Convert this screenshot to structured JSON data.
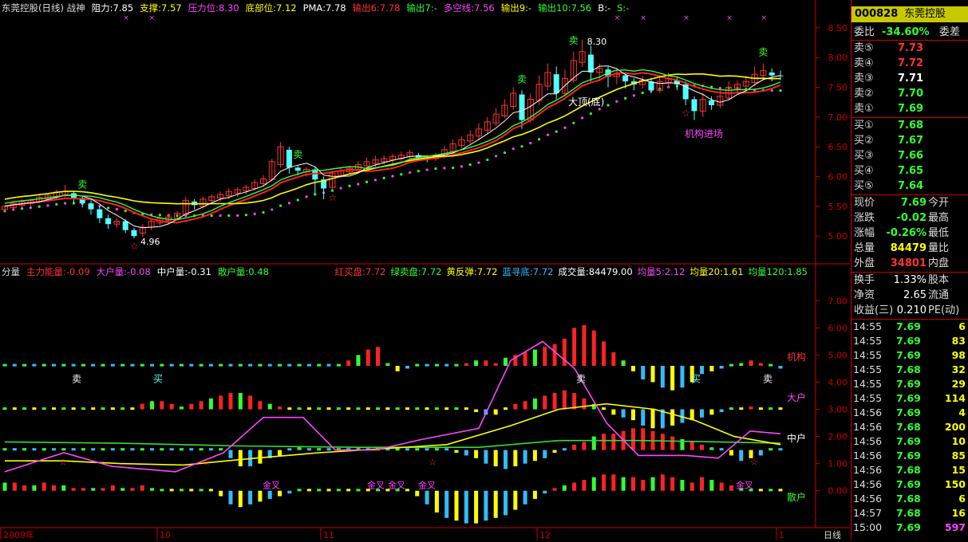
{
  "top_header": {
    "items": [
      {
        "text": "东莞控股(日线) 战神",
        "color": "#dddddd"
      },
      {
        "text": "阻力:7.85",
        "color": "#ffffff"
      },
      {
        "text": "支撑:7.57",
        "color": "#ffff00"
      },
      {
        "text": "压力位:8.30",
        "color": "#ff44ff"
      },
      {
        "text": "底部位:7.12",
        "color": "#ffff00"
      },
      {
        "text": "PMA:7.78",
        "color": "#ffffff"
      },
      {
        "text": "输出6:7.78",
        "color": "#ff3333"
      },
      {
        "text": "输出7:-",
        "color": "#33ff33"
      },
      {
        "text": "多空线:7.56",
        "color": "#ff44ff"
      },
      {
        "text": "输出9:-",
        "color": "#ffff00"
      },
      {
        "text": "输出10:7.56",
        "color": "#33ff33"
      },
      {
        "text": "B:-",
        "color": "#ffffff"
      },
      {
        "text": "S:-",
        "color": "#33ff33"
      }
    ]
  },
  "sub_header": {
    "left_items": [
      {
        "text": "分量",
        "color": "#dddddd"
      },
      {
        "text": "主力能量:-0.09",
        "color": "#ff3333"
      },
      {
        "text": "大户量:-0.08",
        "color": "#ff44ff"
      },
      {
        "text": "中户量:-0.31",
        "color": "#ffffff"
      },
      {
        "text": "散户量:0.48",
        "color": "#33ff33"
      }
    ],
    "right_items": [
      {
        "text": "红买盘:7.72",
        "color": "#ff3333"
      },
      {
        "text": "绿卖盘:7.72",
        "color": "#33ff33"
      },
      {
        "text": "黄反弹:7.72",
        "color": "#ffff00"
      },
      {
        "text": "蓝寻底:7.72",
        "color": "#33bbff"
      },
      {
        "text": "成交量:84479.00",
        "color": "#ffffff"
      },
      {
        "text": "均量5:2.12",
        "color": "#ff44ff"
      },
      {
        "text": "均量20:1.61",
        "color": "#ffff00"
      },
      {
        "text": "均量120:1.85",
        "color": "#33ff33"
      }
    ]
  },
  "chart_data": [
    {
      "type": "candlestick",
      "title": "东莞控股(日线)",
      "y_ticks": [
        "8.50",
        "8.00",
        "7.50",
        "7.00",
        "6.50",
        "6.00",
        "5.50",
        "5.00"
      ],
      "ylim": [
        4.6,
        8.7
      ],
      "x_labels": [
        "2009年",
        "10",
        "11",
        "12",
        "1"
      ],
      "annotations": [
        {
          "text": "大顶(底)",
          "color": "#ffffff"
        },
        {
          "text": "机构进场",
          "color": "#ff44ff"
        },
        {
          "text": "8.30",
          "color": "#ffffff"
        },
        {
          "text": "4.96",
          "color": "#ffffff"
        }
      ],
      "sell_label": "卖",
      "buy_label": "买",
      "candles": [
        [
          5.45,
          5.5,
          5.4,
          5.52
        ],
        [
          5.48,
          5.55,
          5.45,
          5.58
        ],
        [
          5.52,
          5.58,
          5.48,
          5.62
        ],
        [
          5.55,
          5.6,
          5.5,
          5.63
        ],
        [
          5.58,
          5.65,
          5.55,
          5.68
        ],
        [
          5.62,
          5.68,
          5.58,
          5.72
        ],
        [
          5.66,
          5.74,
          5.62,
          5.78
        ],
        [
          5.7,
          5.75,
          5.65,
          5.86
        ],
        [
          5.72,
          5.64,
          5.55,
          5.76
        ],
        [
          5.64,
          5.55,
          5.48,
          5.68
        ],
        [
          5.55,
          5.45,
          5.36,
          5.6
        ],
        [
          5.45,
          5.3,
          5.22,
          5.5
        ],
        [
          5.3,
          5.2,
          5.12,
          5.36
        ],
        [
          5.2,
          5.25,
          5.14,
          5.3
        ],
        [
          5.25,
          5.1,
          5.05,
          5.28
        ],
        [
          5.1,
          5.0,
          4.96,
          5.14
        ],
        [
          5.05,
          5.15,
          4.98,
          5.2
        ],
        [
          5.15,
          5.25,
          5.1,
          5.28
        ],
        [
          5.22,
          5.3,
          5.18,
          5.34
        ],
        [
          5.26,
          5.32,
          5.2,
          5.38
        ],
        [
          5.3,
          5.38,
          5.26,
          5.42
        ],
        [
          5.36,
          5.6,
          5.34,
          5.66
        ],
        [
          5.58,
          5.52,
          5.45,
          5.62
        ],
        [
          5.5,
          5.62,
          5.46,
          5.66
        ],
        [
          5.6,
          5.66,
          5.54,
          5.7
        ],
        [
          5.64,
          5.7,
          5.58,
          5.75
        ],
        [
          5.68,
          5.75,
          5.62,
          5.8
        ],
        [
          5.72,
          5.78,
          5.66,
          5.82
        ],
        [
          5.76,
          5.82,
          5.7,
          5.86
        ],
        [
          5.8,
          5.9,
          5.76,
          5.95
        ],
        [
          5.88,
          5.96,
          5.84,
          6.02
        ],
        [
          5.95,
          6.25,
          5.92,
          6.3
        ],
        [
          6.2,
          6.5,
          6.15,
          6.58
        ],
        [
          6.45,
          6.15,
          6.05,
          6.5
        ],
        [
          6.15,
          6.1,
          6.02,
          6.18
        ],
        [
          6.08,
          6.12,
          6.0,
          6.16
        ],
        [
          6.12,
          5.95,
          5.7,
          6.15
        ],
        [
          5.95,
          5.8,
          5.62,
          6.0
        ],
        [
          5.82,
          6.05,
          5.78,
          6.1
        ],
        [
          6.02,
          6.1,
          5.98,
          6.14
        ],
        [
          6.08,
          6.14,
          6.04,
          6.18
        ],
        [
          6.12,
          6.2,
          6.08,
          6.26
        ],
        [
          6.18,
          6.25,
          6.12,
          6.32
        ],
        [
          6.22,
          6.28,
          6.16,
          6.35
        ],
        [
          6.25,
          6.3,
          6.2,
          6.36
        ],
        [
          6.28,
          6.34,
          6.22,
          6.38
        ],
        [
          6.3,
          6.36,
          6.25,
          6.42
        ],
        [
          6.34,
          6.4,
          6.28,
          6.45
        ],
        [
          6.36,
          6.32,
          6.26,
          6.4
        ],
        [
          6.32,
          6.3,
          6.24,
          6.36
        ],
        [
          6.3,
          6.36,
          6.26,
          6.4
        ],
        [
          6.34,
          6.45,
          6.3,
          6.52
        ],
        [
          6.42,
          6.55,
          6.38,
          6.62
        ],
        [
          6.52,
          6.62,
          6.48,
          6.68
        ],
        [
          6.6,
          6.7,
          6.55,
          6.78
        ],
        [
          6.68,
          6.8,
          6.62,
          6.9
        ],
        [
          6.78,
          6.92,
          6.72,
          7.0
        ],
        [
          6.9,
          7.05,
          6.85,
          7.15
        ],
        [
          7.02,
          7.2,
          6.98,
          7.3
        ],
        [
          7.18,
          7.4,
          7.12,
          7.5
        ],
        [
          7.38,
          6.95,
          6.8,
          7.45
        ],
        [
          6.95,
          7.3,
          6.9,
          7.4
        ],
        [
          7.28,
          7.55,
          7.2,
          7.7
        ],
        [
          7.52,
          7.75,
          7.45,
          7.9
        ],
        [
          7.72,
          7.4,
          7.3,
          7.85
        ],
        [
          7.4,
          7.65,
          7.35,
          7.8
        ],
        [
          7.62,
          7.95,
          7.58,
          8.1
        ],
        [
          7.92,
          8.1,
          7.85,
          8.3
        ],
        [
          8.05,
          7.75,
          7.6,
          8.2
        ],
        [
          7.75,
          7.82,
          7.6,
          7.9
        ],
        [
          7.8,
          7.68,
          7.5,
          7.85
        ],
        [
          7.68,
          7.72,
          7.55,
          7.8
        ],
        [
          7.7,
          7.6,
          7.48,
          7.75
        ],
        [
          7.6,
          7.55,
          7.45,
          7.65
        ],
        [
          7.55,
          7.62,
          7.48,
          7.7
        ],
        [
          7.6,
          7.45,
          7.4,
          7.66
        ],
        [
          7.45,
          7.6,
          7.4,
          7.7
        ],
        [
          7.58,
          7.65,
          7.5,
          7.75
        ],
        [
          7.62,
          7.55,
          7.45,
          7.68
        ],
        [
          7.55,
          7.3,
          7.2,
          7.6
        ],
        [
          7.3,
          7.1,
          6.95,
          7.35
        ],
        [
          7.1,
          7.3,
          7.0,
          7.4
        ],
        [
          7.28,
          7.2,
          7.12,
          7.35
        ],
        [
          7.2,
          7.35,
          7.15,
          7.45
        ],
        [
          7.32,
          7.5,
          7.28,
          7.6
        ],
        [
          7.48,
          7.55,
          7.42,
          7.62
        ],
        [
          7.52,
          7.6,
          7.48,
          7.7
        ],
        [
          7.58,
          7.72,
          7.52,
          7.85
        ],
        [
          7.7,
          7.78,
          7.62,
          7.9
        ],
        [
          7.75,
          7.7,
          7.6,
          7.82
        ],
        [
          7.7,
          7.69,
          7.62,
          7.78
        ]
      ]
    },
    {
      "type": "bar",
      "title": "分量",
      "y_ticks": [
        "7.00",
        "6.00",
        "5.00",
        "4.00",
        "3.00",
        "2.00",
        "1.00",
        "0.00"
      ],
      "ylim": [
        -1.3,
        7.8
      ],
      "row_labels": [
        {
          "text": "机构",
          "color": "#ff3333"
        },
        {
          "text": "大户",
          "color": "#ff44ff"
        },
        {
          "text": "中户",
          "color": "#ffffff"
        },
        {
          "text": "散户",
          "color": "#33ff33"
        }
      ],
      "buy_label": "买",
      "sell_label": "卖",
      "cross_label": "金叉"
    }
  ],
  "bottom_axis": {
    "period_label": "日线"
  },
  "quote": {
    "code": "000828",
    "name": "东莞控股",
    "ratio_label": "委比",
    "ratio_value": "-34.60%",
    "diff_label": "委差",
    "asks": [
      {
        "label": "卖⑤",
        "price": "7.73",
        "color": "#ff3333"
      },
      {
        "label": "卖④",
        "price": "7.72",
        "color": "#ff3333"
      },
      {
        "label": "卖③",
        "price": "7.71",
        "color": "#ffffff"
      },
      {
        "label": "卖②",
        "price": "7.70",
        "color": "#33ff33"
      },
      {
        "label": "卖①",
        "price": "7.69",
        "color": "#33ff33"
      }
    ],
    "bids": [
      {
        "label": "买①",
        "price": "7.68",
        "color": "#33ff33"
      },
      {
        "label": "买②",
        "price": "7.67",
        "color": "#33ff33"
      },
      {
        "label": "买③",
        "price": "7.66",
        "color": "#33ff33"
      },
      {
        "label": "买④",
        "price": "7.65",
        "color": "#33ff33"
      },
      {
        "label": "买⑤",
        "price": "7.64",
        "color": "#33ff33"
      }
    ],
    "stats": [
      {
        "label": "现价",
        "value": "7.69",
        "color": "#33ff33",
        "label2": "今开"
      },
      {
        "label": "涨跌",
        "value": "-0.02",
        "color": "#33ff33",
        "label2": "最高"
      },
      {
        "label": "涨幅",
        "value": "-0.26%",
        "color": "#33ff33",
        "label2": "最低"
      },
      {
        "label": "总量",
        "value": "84479",
        "color": "#ffff00",
        "label2": "量比"
      },
      {
        "label": "外盘",
        "value": "34801",
        "color": "#ff3333",
        "label2": "内盘"
      }
    ],
    "stats2": [
      {
        "label": "换手",
        "value": "1.33%",
        "label2": "股本"
      },
      {
        "label": "净资",
        "value": "2.65",
        "label2": "流通"
      },
      {
        "label": "收益(三)",
        "value": "0.210",
        "label2": "PE(动)"
      }
    ],
    "ticks": [
      {
        "time": "14:55",
        "price": "7.69",
        "vol": "6",
        "color": "#ffff00"
      },
      {
        "time": "14:55",
        "price": "7.69",
        "vol": "83",
        "color": "#ffff00"
      },
      {
        "time": "14:55",
        "price": "7.69",
        "vol": "98",
        "color": "#ffff00"
      },
      {
        "time": "14:55",
        "price": "7.68",
        "vol": "32",
        "color": "#ffff00"
      },
      {
        "time": "14:55",
        "price": "7.69",
        "vol": "29",
        "color": "#ffff00"
      },
      {
        "time": "14:55",
        "price": "7.69",
        "vol": "114",
        "color": "#ffff00"
      },
      {
        "time": "14:56",
        "price": "7.69",
        "vol": "4",
        "color": "#ffff00"
      },
      {
        "time": "14:56",
        "price": "7.68",
        "vol": "200",
        "color": "#ffff00"
      },
      {
        "time": "14:56",
        "price": "7.69",
        "vol": "10",
        "color": "#ffff00"
      },
      {
        "time": "14:56",
        "price": "7.69",
        "vol": "85",
        "color": "#ffff00"
      },
      {
        "time": "14:56",
        "price": "7.68",
        "vol": "15",
        "color": "#ffff00"
      },
      {
        "time": "14:56",
        "price": "7.69",
        "vol": "150",
        "color": "#ffff00"
      },
      {
        "time": "14:56",
        "price": "7.68",
        "vol": "6",
        "color": "#ffff00"
      },
      {
        "time": "14:57",
        "price": "7.68",
        "vol": "16",
        "color": "#ffff00"
      },
      {
        "time": "15:00",
        "price": "7.69",
        "vol": "597",
        "color": "#ff44ff"
      }
    ]
  }
}
